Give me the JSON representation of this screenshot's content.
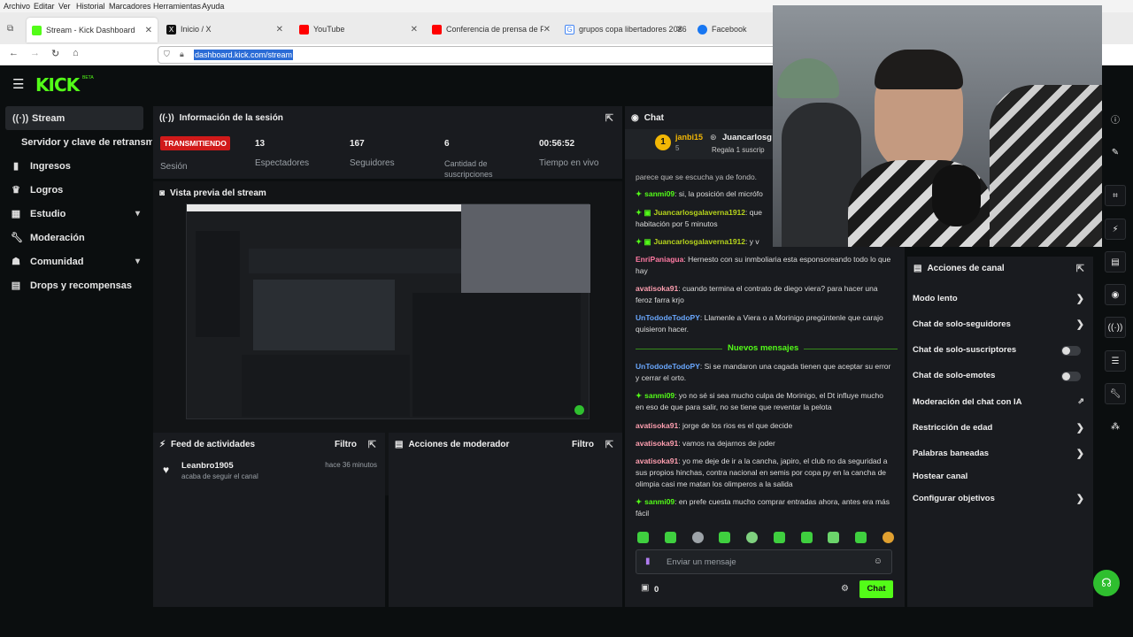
{
  "browser": {
    "menu": [
      "Archivo",
      "Editar",
      "Ver",
      "Historial",
      "Marcadores",
      "Herramientas",
      "Ayuda"
    ],
    "tabs": [
      {
        "label": "Stream - Kick Dashboard",
        "favicon_color": "#53fc18"
      },
      {
        "label": "Inicio / X",
        "favicon_color": "#111111"
      },
      {
        "label": "YouTube",
        "favicon_color": "#ff0000"
      },
      {
        "label": "Conferencia de prensa de Franc",
        "favicon_color": "#ff0000"
      },
      {
        "label": "grupos copa libertadores 2026",
        "favicon_color": "#4285f4"
      },
      {
        "label": "Facebook",
        "favicon_color": "#1877f2"
      }
    ],
    "url": "dashboard.kick.com/stream"
  },
  "app": {
    "logo": "KICK",
    "logo_beta": "BETA",
    "accent": "#53fc18",
    "sidebar": [
      {
        "label": "Stream",
        "icon": "stream-icon",
        "active": true
      },
      {
        "label": "Servidor y clave de retransmisión",
        "icon": "",
        "sub": true
      },
      {
        "label": "Ingresos",
        "icon": "chart-icon"
      },
      {
        "label": "Logros",
        "icon": "trophy-icon"
      },
      {
        "label": "Estudio",
        "icon": "studio-icon",
        "expand": true
      },
      {
        "label": "Moderación",
        "icon": "wrench-icon"
      },
      {
        "label": "Comunidad",
        "icon": "community-icon",
        "expand": true
      },
      {
        "label": "Drops y recompensas",
        "icon": "drops-icon"
      }
    ],
    "session": {
      "title": "Información de la sesión",
      "live_badge": "TRANSMITIENDO",
      "stats": [
        {
          "value": "13",
          "label": "Espectadores"
        },
        {
          "value": "167",
          "label": "Seguidores"
        },
        {
          "value": "6",
          "label": "Cantidad de suscripciones"
        },
        {
          "value": "00:56:52",
          "label": "Tiempo en vivo"
        }
      ],
      "session_label": "Sesión"
    },
    "preview": {
      "title": "Vista previa del stream"
    },
    "activity": {
      "title": "Feed de actividades",
      "filter": "Filtro",
      "items": [
        {
          "user": "Leanbro1905",
          "action": "acaba de seguir el canal",
          "time": "hace 36 minutos"
        }
      ]
    },
    "mod_actions": {
      "title": "Acciones de moderador",
      "filter": "Filtro"
    },
    "chat": {
      "title": "Chat",
      "pinned": {
        "user": "janbi15",
        "count": "5",
        "target": "Juancarlosg",
        "text": "Regala 1 suscrip"
      },
      "top_fragment": "parece que se escucha ya de fondo.",
      "messages_old": [
        {
          "user": "sanmi09",
          "text": "si, la posición del micrófo",
          "color": "#53fc18",
          "badge": true
        },
        {
          "user": "Juancarlosgalaverna1912",
          "text": "que",
          "color": "#b7d41c",
          "badge": true,
          "extra": "habitación por 5 minutos"
        },
        {
          "user": "Juancarlosgalaverna1912",
          "text": "y v",
          "color": "#b7d41c",
          "badge": true
        },
        {
          "user": "EnriPaniagua",
          "text": "Hernesto con su inmboliaria esta esponsoreando todo lo que hay",
          "color": "#ff7aa3"
        },
        {
          "user": "avatisoka91",
          "text": "cuando termina el contrato de diego viera? para hacer una feroz farra krjo",
          "color": "#ff9fb0"
        },
        {
          "user": "UnTododeTodoPY",
          "text": "Llamenle a Viera o a Morinigo pregúntenle que carajo quisieron hacer.",
          "color": "#6aa8ff"
        }
      ],
      "new_messages_label": "Nuevos mensajes",
      "messages_new": [
        {
          "user": "UnTododeTodoPY",
          "text": "Si se mandaron una cagada tienen que aceptar su error y cerrar el orto.",
          "color": "#6aa8ff"
        },
        {
          "user": "sanmi09",
          "text": "yo no sé si sea mucho culpa de Morinigo, el Dt influye mucho en eso de que para salir, no se tiene que reventar la pelota",
          "color": "#53fc18",
          "badge": true
        },
        {
          "user": "avatisoka91",
          "text": "jorge de los rios es el que decide",
          "color": "#ff9fb0"
        },
        {
          "user": "avatisoka91",
          "text": "vamos na dejarnos de joder",
          "color": "#ff9fb0"
        },
        {
          "user": "avatisoka91",
          "text": "yo me deje de ir a la cancha, japiro, el club no da seguridad a sus propios hinchas, contra nacional en semis por copa py en la cancha de olimpia casi me matan los olimperos a la salida",
          "color": "#ff9fb0"
        },
        {
          "user": "sanmi09",
          "text": "en prefe cuesta mucho comprar entradas ahora, antes era más fácil",
          "color": "#53fc18",
          "badge": true
        }
      ],
      "input_placeholder": "Enviar un mensaje",
      "send_label": "Chat",
      "points": "0"
    },
    "channel_actions": {
      "title": "Acciones de canal",
      "items": [
        {
          "label": "Modo lento",
          "kind": "arrow"
        },
        {
          "label": "Chat de solo-seguidores",
          "kind": "arrow"
        },
        {
          "label": "Chat de solo-suscriptores",
          "kind": "toggle"
        },
        {
          "label": "Chat de solo-emotes",
          "kind": "toggle"
        },
        {
          "label": "Moderación del chat con IA",
          "kind": "external"
        },
        {
          "label": "Restricción de edad",
          "kind": "arrow"
        },
        {
          "label": "Palabras baneadas",
          "kind": "arrow"
        },
        {
          "label": "Hostear canal",
          "kind": "none"
        },
        {
          "label": "Configurar objetivos",
          "kind": "arrow"
        }
      ]
    }
  }
}
